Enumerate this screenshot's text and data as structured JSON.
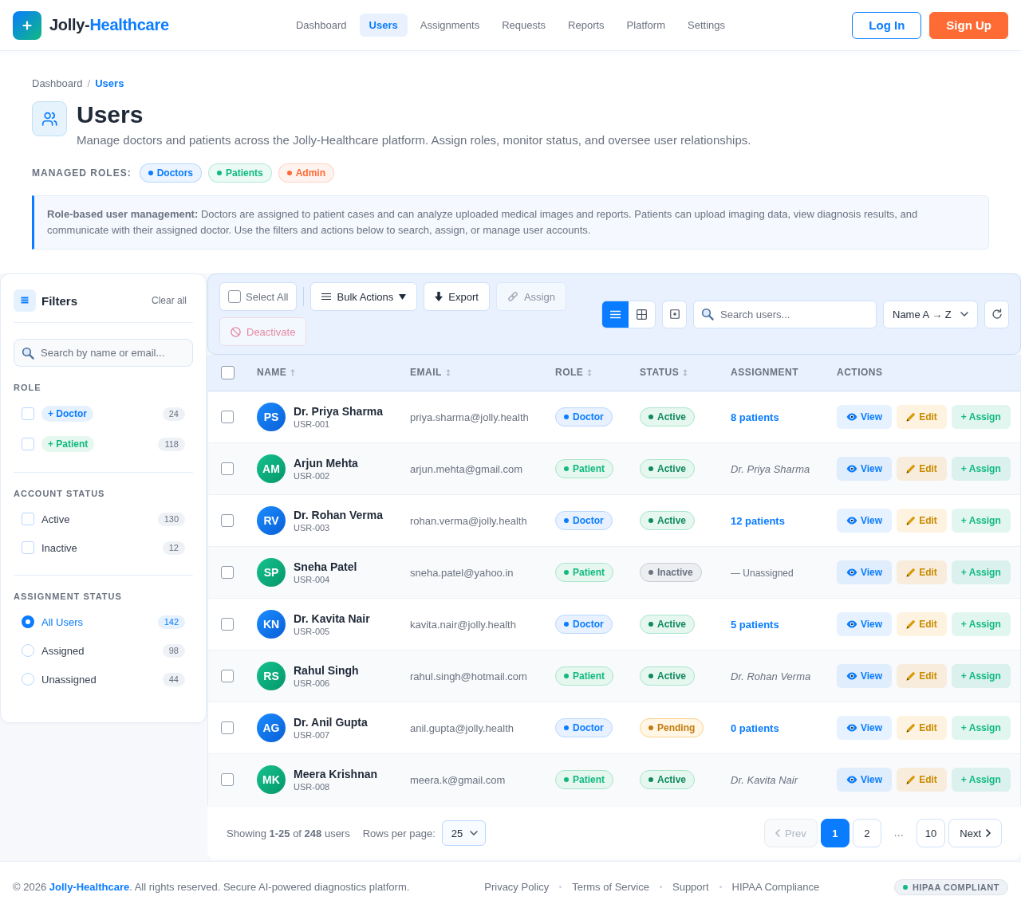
{
  "header": {
    "brand": {
      "first": "Jolly-",
      "second": "Healthcare"
    },
    "nav": [
      {
        "label": "Dashboard",
        "selected": false
      },
      {
        "label": "Users",
        "selected": true
      },
      {
        "label": "Assignments",
        "selected": false
      },
      {
        "label": "Requests",
        "selected": false
      },
      {
        "label": "Reports",
        "selected": false
      },
      {
        "label": "Platform",
        "selected": false
      },
      {
        "label": "Settings",
        "selected": false
      }
    ],
    "login": "Log In",
    "signup": "Sign Up"
  },
  "breadcrumb": {
    "separator": "/",
    "items": [
      {
        "label": "Dashboard",
        "current": false
      },
      {
        "label": "Users",
        "current": true
      }
    ]
  },
  "page": {
    "title": "Users",
    "subtitle": "Manage doctors and patients across the Jolly-Healthcare platform. Assign roles, monitor status, and oversee user relationships.",
    "roles_label": "MANAGED ROLES:",
    "roles": [
      {
        "label": "Doctors",
        "color": "#0a7cff"
      },
      {
        "label": "Patients",
        "color": "#10b981"
      },
      {
        "label": "Admin",
        "color": "#ff6b35"
      }
    ],
    "info": "**Role-based user management:** Doctors are assigned to patient cases and can analyze uploaded medical images and reports. Patients can upload imaging data, view diagnosis results, and communicate with their assigned doctor. Use the filters and actions below to search, assign, or manage user accounts."
  },
  "filters": {
    "title": "Filters",
    "clear": "Clear all",
    "search_placeholder": "Search by name or email...",
    "sections": [
      {
        "title": "ROLE",
        "kind": "checkbox",
        "items": [
          {
            "label": "+ Doctor",
            "kind": "doctor",
            "count": "24",
            "checked": false
          },
          {
            "label": "+ Patient",
            "kind": "patient",
            "count": "118",
            "checked": false
          }
        ]
      },
      {
        "title": "ACCOUNT STATUS",
        "kind": "checkbox",
        "items": [
          {
            "label": "Active",
            "count": "130",
            "checked": false
          },
          {
            "label": "Inactive",
            "count": "12",
            "checked": false
          }
        ]
      },
      {
        "title": "ASSIGNMENT STATUS",
        "kind": "radio",
        "items": [
          {
            "label": "All Users",
            "count": "142",
            "selected": true
          },
          {
            "label": "Assigned",
            "count": "98",
            "selected": false
          },
          {
            "label": "Unassigned",
            "count": "44",
            "selected": false
          }
        ]
      }
    ]
  },
  "toolbar": {
    "select_all": {
      "label": "Select All",
      "checked": false
    },
    "buttons": [
      {
        "label": "Bulk Actions",
        "kind": "bulk",
        "disabled": false
      },
      {
        "label": "Export",
        "kind": "export",
        "disabled": false
      },
      {
        "label": "Assign",
        "kind": "assign",
        "disabled": true
      },
      {
        "label": "Deactivate",
        "kind": "deactivate",
        "disabled": true
      }
    ],
    "views": [
      {
        "kind": "list",
        "selected": true
      },
      {
        "kind": "grid",
        "selected": false
      }
    ],
    "search_placeholder": "Search users...",
    "sort": "Name A → Z"
  },
  "table": {
    "select_all_checked": false,
    "columns": [
      {
        "label": "NAME",
        "kind": "ascending"
      },
      {
        "label": "EMAIL",
        "kind": "sortable"
      },
      {
        "label": "ROLE",
        "kind": "sortable"
      },
      {
        "label": "STATUS",
        "kind": "sortable"
      },
      {
        "label": "ASSIGNMENT"
      },
      {
        "label": "ACTIONS"
      }
    ],
    "rows": [
      {
        "checked": false,
        "initials": "PS",
        "name": "Dr. Priya Sharma",
        "id": "USR-001",
        "email": "priya.sharma@jolly.health",
        "role": {
          "label": "Doctor",
          "kind": "doctor"
        },
        "status": {
          "label": "Active",
          "kind": "active"
        },
        "assignment": {
          "label": "8 patients",
          "kind": "patients"
        },
        "actions": {
          "view": "View",
          "edit": "Edit",
          "assign": "+ Assign"
        }
      },
      {
        "checked": false,
        "initials": "AM",
        "name": "Arjun Mehta",
        "id": "USR-002",
        "email": "arjun.mehta@gmail.com",
        "role": {
          "label": "Patient",
          "kind": "patient"
        },
        "status": {
          "label": "Active",
          "kind": "active"
        },
        "assignment": {
          "label": "Dr. Priya Sharma",
          "kind": "doctor"
        },
        "actions": {
          "view": "View",
          "edit": "Edit",
          "assign": "+ Assign"
        }
      },
      {
        "checked": false,
        "initials": "RV",
        "name": "Dr. Rohan Verma",
        "id": "USR-003",
        "email": "rohan.verma@jolly.health",
        "role": {
          "label": "Doctor",
          "kind": "doctor"
        },
        "status": {
          "label": "Active",
          "kind": "active"
        },
        "assignment": {
          "label": "12 patients",
          "kind": "patients"
        },
        "actions": {
          "view": "View",
          "edit": "Edit",
          "assign": "+ Assign"
        }
      },
      {
        "checked": false,
        "initials": "SP",
        "name": "Sneha Patel",
        "id": "USR-004",
        "email": "sneha.patel@yahoo.in",
        "role": {
          "label": "Patient",
          "kind": "patient"
        },
        "status": {
          "label": "Inactive",
          "kind": "inactive"
        },
        "assignment": {
          "label": "— Unassigned",
          "kind": "none"
        },
        "actions": {
          "view": "View",
          "edit": "Edit",
          "assign": "+ Assign"
        }
      },
      {
        "checked": false,
        "initials": "KN",
        "name": "Dr. Kavita Nair",
        "id": "USR-005",
        "email": "kavita.nair@jolly.health",
        "role": {
          "label": "Doctor",
          "kind": "doctor"
        },
        "status": {
          "label": "Active",
          "kind": "active"
        },
        "assignment": {
          "label": "5 patients",
          "kind": "patients"
        },
        "actions": {
          "view": "View",
          "edit": "Edit",
          "assign": "+ Assign"
        }
      },
      {
        "checked": false,
        "initials": "RS",
        "name": "Rahul Singh",
        "id": "USR-006",
        "email": "rahul.singh@hotmail.com",
        "role": {
          "label": "Patient",
          "kind": "patient"
        },
        "status": {
          "label": "Active",
          "kind": "active"
        },
        "assignment": {
          "label": "Dr. Rohan Verma",
          "kind": "doctor"
        },
        "actions": {
          "view": "View",
          "edit": "Edit",
          "assign": "+ Assign"
        }
      },
      {
        "checked": false,
        "initials": "AG",
        "name": "Dr. Anil Gupta",
        "id": "USR-007",
        "email": "anil.gupta@jolly.health",
        "role": {
          "label": "Doctor",
          "kind": "doctor"
        },
        "status": {
          "label": "Pending",
          "kind": "pending"
        },
        "assignment": {
          "label": "0 patients",
          "kind": "patients"
        },
        "actions": {
          "view": "View",
          "edit": "Edit",
          "assign": "+ Assign"
        }
      },
      {
        "checked": false,
        "initials": "MK",
        "name": "Meera Krishnan",
        "id": "USR-008",
        "email": "meera.k@gmail.com",
        "role": {
          "label": "Patient",
          "kind": "patient"
        },
        "status": {
          "label": "Active",
          "kind": "active"
        },
        "assignment": {
          "label": "Dr. Kavita Nair",
          "kind": "doctor"
        },
        "actions": {
          "view": "View",
          "edit": "Edit",
          "assign": "+ Assign"
        }
      }
    ]
  },
  "pagination": {
    "summary": "Showing **1-25** of **248** users",
    "rows_label": "Rows per page:",
    "rows_value": "25",
    "prev": {
      "label": "Prev",
      "disabled": true
    },
    "pages": [
      {
        "label": "1",
        "kind": "page",
        "selected": true
      },
      {
        "label": "2",
        "kind": "page",
        "selected": false
      },
      {
        "label": "…",
        "kind": "ellipsis"
      },
      {
        "label": "10",
        "kind": "page",
        "selected": false
      }
    ],
    "next": {
      "label": "Next",
      "disabled": false
    }
  },
  "footer": {
    "copyright": {
      "before": "© 2026 ",
      "link": "Jolly-Healthcare",
      "after": ". All rights reserved. Secure AI-powered diagnostics platform."
    },
    "links": [
      "Privacy Policy",
      "Terms of Service",
      "Support",
      "HIPAA Compliance"
    ],
    "badge": "HIPAA COMPLIANT"
  }
}
